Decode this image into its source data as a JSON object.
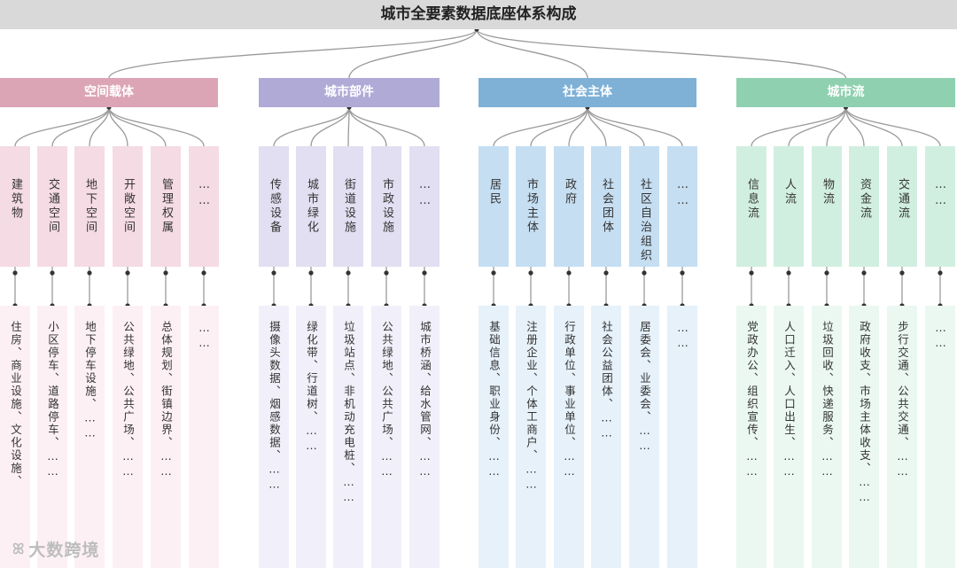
{
  "title": "城市全要素数据底座体系构成",
  "watermark": "大数跨境",
  "categories": [
    {
      "name": "空间载体",
      "color": "#dca5b6",
      "sub_bg": "#f5dbe4",
      "det_bg": "#fdf0f5",
      "items": [
        {
          "label": "建筑物",
          "detail": "住房、商业设施、文化设施、"
        },
        {
          "label": "交通空间",
          "detail": "小区停车、道路停车、……"
        },
        {
          "label": "地下空间",
          "detail": "地下停车设施、……"
        },
        {
          "label": "开敞空间",
          "detail": "公共绿地、公共广场、……"
        },
        {
          "label": "管理权属",
          "detail": "总体规划、街镇边界、……"
        },
        {
          "label": "……",
          "detail": "……"
        }
      ]
    },
    {
      "name": "城市部件",
      "color": "#b0aad6",
      "sub_bg": "#e1dff1",
      "det_bg": "#f1f0fa",
      "items": [
        {
          "label": "传感设备",
          "detail": "摄像头数据、烟感数据、……"
        },
        {
          "label": "城市绿化",
          "detail": "绿化带、行道树、……"
        },
        {
          "label": "街道设施",
          "detail": "垃圾站点、非机动充电桩、……"
        },
        {
          "label": "市政设施",
          "detail": "公共绿地、公共广场、……"
        },
        {
          "label": "……",
          "detail": "城市桥涵、给水管网、……"
        }
      ]
    },
    {
      "name": "社会主体",
      "color": "#7fb0d6",
      "sub_bg": "#c5def2",
      "det_bg": "#e6f1fa",
      "items": [
        {
          "label": "居民",
          "detail": "基础信息、职业身份、……"
        },
        {
          "label": "市场主体",
          "detail": "注册企业、个体工商户、……"
        },
        {
          "label": "政府",
          "detail": "行政单位、事业单位、……"
        },
        {
          "label": "社会团体",
          "detail": "社会公益团体、……"
        },
        {
          "label": "社区自治组织",
          "detail": "居委会、业委会、……"
        },
        {
          "label": "……",
          "detail": "……"
        }
      ]
    },
    {
      "name": "城市流",
      "color": "#8fd0b0",
      "sub_bg": "#d1efe1",
      "det_bg": "#ebf8f2",
      "items": [
        {
          "label": "信息流",
          "detail": "党政办公、组织宣传、……"
        },
        {
          "label": "人流",
          "detail": "人口迁入、人口出生、……"
        },
        {
          "label": "物流",
          "detail": "垃圾回收、快递服务、……"
        },
        {
          "label": "资金流",
          "detail": "政府收支、市场主体收支、……"
        },
        {
          "label": "交通流",
          "detail": "步行交通、公共交通、……"
        },
        {
          "label": "……",
          "detail": "……"
        }
      ]
    }
  ]
}
